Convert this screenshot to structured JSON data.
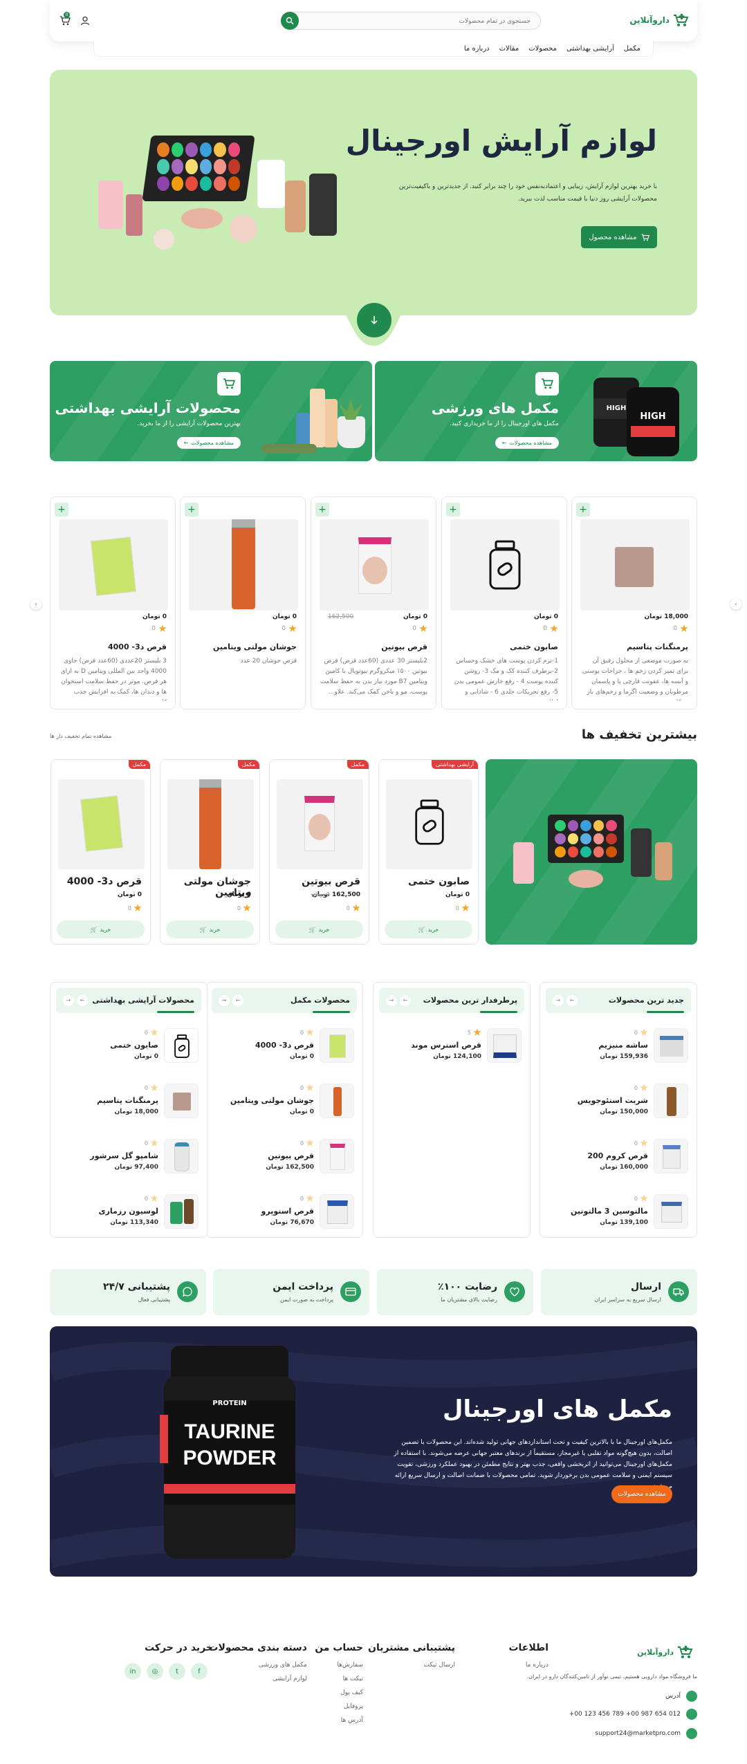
{
  "header": {
    "logo_text": "داروآنلاین",
    "search_placeholder": "جستجوی در تمام محصولات",
    "cart_count": "0"
  },
  "nav": {
    "items": [
      "مکمل",
      "آرایشی بهداشتی",
      "محصولات",
      "مقالات",
      "درباره ما"
    ]
  },
  "hero": {
    "title": "لوازم آرایش اورجینال",
    "desc": "با خرید بهترین لوازم آرایش، زیبایی و اعتماد‌به‌نفس خود را چند برابر کنید. از جدیدترین و باکیفیت‌ترین محصولات آرایشی روز دنیا با قیمت مناسب لذت ببرید.",
    "button": "مشاهده محصول"
  },
  "categories": [
    {
      "title": "مکمل های ورزشی",
      "subtitle": "مکمل های اورجینال را از ما خریداری کنید.",
      "button": "مشاهده محصولات"
    },
    {
      "title": "محصولات آرایشی بهداشتی",
      "subtitle": "بهترین محصولات آرایشی را از ما بخرید.",
      "button": "مشاهده محصولات"
    }
  ],
  "products": [
    {
      "name": "پرمنگنات پتاسیم",
      "price": "18,000",
      "unit": "تومان",
      "rating": "0",
      "desc": "به صورت موضعی از محلول رقیق آن برای تمیز کردن زخم ها ، جراحات پوستی و آبسه ها، عفونت قارچی پا و پاسمان مرطوبان و وضعیت اگزما و زخم‌های باز به کار م..."
    },
    {
      "name": "صابون ختمی",
      "price": "0",
      "unit": "تومان",
      "rating": "0",
      "desc": "1-نرم کردن پوست های خشک وحساس 2-برطرف کننده کک و مک 3- روشن کننده پوست 4 - رفع خارش عمومی بدن 5- رفع تحریکات جلدی 6 - شادابی و لطاف..."
    },
    {
      "name": "قرص بیوتین",
      "price": "0",
      "old": "162,500",
      "unit": "تومان",
      "rating": "0",
      "desc": "2بلیستر 30 عددی (60عدد قرص) قرص بیوتین ۱۵۰۰ میکروگرم بیوتوپال با کامین ویتامین B7 مورد نیاز بدن به حفظ سلامت پوست، مو و ناخن کمک می‌کند. علاو..."
    },
    {
      "name": "جوشان مولتی ویتامین",
      "price": "0",
      "unit": "تومان",
      "rating": "0",
      "desc": "قرص جوشان 20 عدد"
    },
    {
      "name": "قرص د3- 4000",
      "price": "0",
      "unit": "تومان",
      "rating": "0",
      "desc": "3 بلیستر 20عددی (60عدد قرص) حاوی 4000 واحد بین المللی ویتامین D به ازای هر قرص. موثر در حفظ سلامت استخوان ها و دندان ها، کمک به افزایش جذب کلسی..."
    }
  ],
  "discounts": {
    "title": "بیشترین تخفیف ها",
    "link": "مشاهده تمام تخفیف دار ها",
    "items": [
      {
        "name": "صابون ختمی",
        "price": "0 تومان",
        "badge": "آرایشی بهداشتی",
        "rating": "0",
        "buy": "خرید"
      },
      {
        "name": "قرص بیوتین",
        "price": "162,500 تومان",
        "old": "0 تومان",
        "badge": "مکمل",
        "rating": "0",
        "buy": "خرید"
      },
      {
        "name": "جوشان مولتی ویتامین",
        "price": "0 تومان",
        "badge": "مکمل",
        "rating": "0",
        "buy": "خرید"
      },
      {
        "name": "قرص د3- 4000",
        "price": "0 تومان",
        "badge": "مکمل",
        "rating": "0",
        "buy": "خرید"
      }
    ]
  },
  "columns": [
    {
      "title": "جدید ترین محصولات",
      "items": [
        {
          "name": "ساشه منیزیم",
          "price": "159,936",
          "rating": "0"
        },
        {
          "name": "شربت استئوجویس",
          "price": "150,000",
          "rating": "0"
        },
        {
          "name": "قرص کروم 200",
          "price": "160,000",
          "rating": "0"
        },
        {
          "name": "مالتوسین 3 مالتوتین",
          "price": "139,100",
          "rating": "0"
        }
      ]
    },
    {
      "title": "پرطرفدار ترین محصولات",
      "items": [
        {
          "name": "قرص استرس موند",
          "price": "124,100",
          "rating": "5"
        }
      ]
    },
    {
      "title": "محصولات مکمل",
      "items": [
        {
          "name": "قرص د3- 4000",
          "price": "0",
          "rating": "0"
        },
        {
          "name": "جوشان مولتی ویتامین",
          "price": "0",
          "rating": "0"
        },
        {
          "name": "قرص بیوتین",
          "price": "162,500",
          "rating": "0"
        },
        {
          "name": "قرص استوپرو",
          "price": "76,670",
          "rating": "0"
        }
      ]
    },
    {
      "title": "محصولات آرایشی بهداشتی",
      "items": [
        {
          "name": "صابون ختمی",
          "price": "0",
          "rating": "0"
        },
        {
          "name": "پرمنگنات پتاسیم",
          "price": "18,000",
          "rating": "0"
        },
        {
          "name": "شامپو گل سرشور",
          "price": "97,400",
          "rating": "0"
        },
        {
          "name": "لوسیون رزماری",
          "price": "113,340",
          "rating": "0"
        }
      ]
    }
  ],
  "price_unit": "تومان",
  "features": [
    {
      "title": "ارسال",
      "sub": "ارسال سریع به سراسر ایران"
    },
    {
      "title": "رضایت ۱۰۰٪",
      "sub": "رضایت بالای مشتریان ما"
    },
    {
      "title": "پرداخت ایمن",
      "sub": "پرداخت به صورت ایمن"
    },
    {
      "title": "پشتیبانی ۲۴/۷",
      "sub": "پشتیبانی فعال"
    }
  ],
  "promo": {
    "title": "مکمل های اورجینال",
    "desc": "مکمل‌های اورجینال ما با بالاترین کیفیت و تحت استانداردهای جهانی تولید شده‌اند. این محصولات با تضمین اصالت، بدون هیچ‌گونه مواد تقلبی یا غیرمجاز، مستقیماً از برندهای معتبر جهانی عرضه می‌شوند. با استفاده از مکمل‌های اورجینال می‌توانید از اثربخشی واقعی، جذب بهتر و نتایج مطمئن در بهبود عملکرد ورزشی، تقویت سیستم ایمنی و سلامت عمومی بدن برخوردار شوید. تمامی محصولات با ضمانت اصالت و ارسال سریع ارائه می‌شوند.",
    "button": "مشاهده محصولات",
    "jar_brand": "PROTEIN",
    "jar_line1": "TAURINE",
    "jar_line2": "POWDER"
  },
  "footer": {
    "about": "ما فروشگاه مواد دارویی هستیم، تیمی نوآور از تامین‌کنندگان دارو در ایران.",
    "address": "آدرس",
    "phone": "012 654 987 00+    789 456 123 00+",
    "email": "support24@marketpro.com",
    "cols": [
      {
        "title": "اطلاعات",
        "items": [
          "درباره ما"
        ]
      },
      {
        "title": "پشتیبانی مشتریان",
        "items": [
          "ارسال تیکت"
        ]
      },
      {
        "title": "حساب من",
        "items": [
          "سفارش‌ها",
          "تیکت ها",
          "کیف پول",
          "پروفایل",
          "آدرس ها"
        ]
      },
      {
        "title": "دسته بندی محصولات",
        "items": [
          "مکمل های ورزشی",
          "لوازم آرایشی"
        ]
      },
      {
        "title": "خرید در حرکت",
        "items": []
      }
    ]
  },
  "colors": {
    "brand": "#1f8a4c",
    "hero_bg": "#c9ebb4",
    "promo_bg": "#1e2240",
    "accent": "#f06a1a",
    "badge": "#e23d3d"
  }
}
